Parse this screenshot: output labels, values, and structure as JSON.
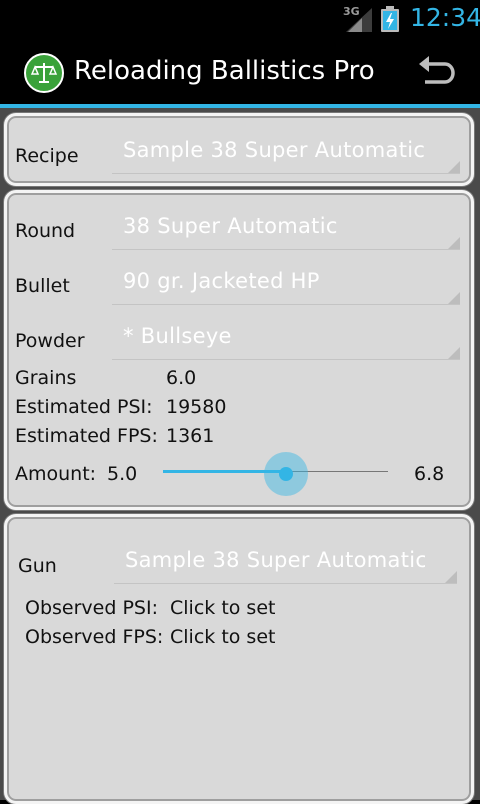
{
  "status_bar": {
    "network": "3G",
    "time": "12:34"
  },
  "action_bar": {
    "title": "Reloading Ballistics Pro"
  },
  "recipe": {
    "label": "Recipe",
    "value": "Sample 38 Super Automatic"
  },
  "round": {
    "label": "Round",
    "value": "38 Super Automatic"
  },
  "bullet": {
    "label": "Bullet",
    "value": "90 gr. Jacketed HP"
  },
  "powder": {
    "label": "Powder",
    "value": "* Bullseye"
  },
  "stats": {
    "grains_label": "Grains",
    "grains_value": "6.0",
    "psi_label": "Estimated PSI:",
    "psi_value": "19580",
    "fps_label": "Estimated FPS:",
    "fps_value": "1361"
  },
  "amount": {
    "label": "Amount:",
    "min_label": "5.0",
    "max_label": "6.8",
    "min": 5.0,
    "max": 6.8,
    "value": 6.0
  },
  "gun": {
    "label": "Gun",
    "value": "Sample 38 Super Automatic"
  },
  "observed": {
    "psi_label": "Observed PSI:",
    "psi_value": "Click to set",
    "fps_label": "Observed FPS:",
    "fps_value": "Click to set"
  },
  "colors": {
    "accent": "#33b5e5",
    "logo_green": "#3aa23a"
  }
}
